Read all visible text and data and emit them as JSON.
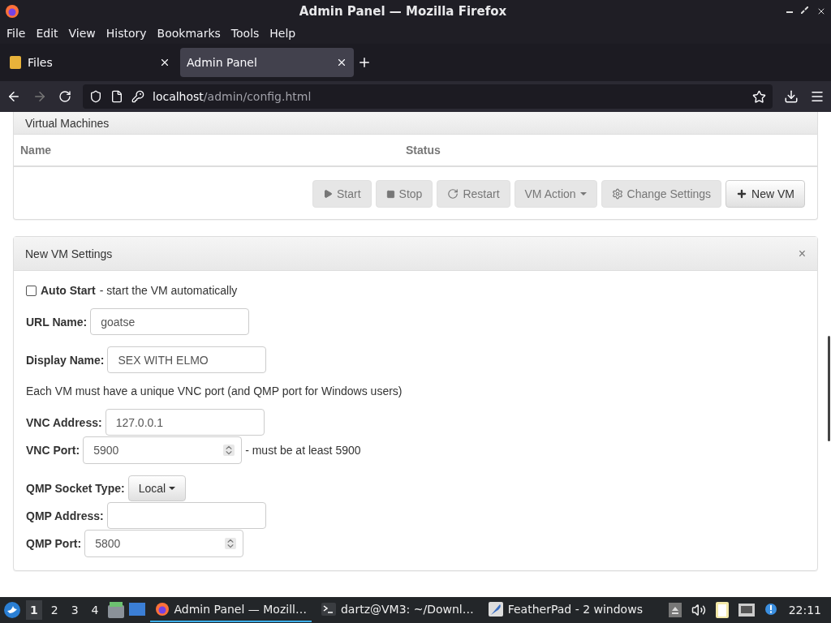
{
  "window": {
    "title": "Admin Panel — Mozilla Firefox"
  },
  "menu": [
    "File",
    "Edit",
    "View",
    "History",
    "Bookmarks",
    "Tools",
    "Help"
  ],
  "tabs": [
    {
      "label": "Files",
      "selected": false
    },
    {
      "label": "Admin Panel",
      "selected": true
    }
  ],
  "address": {
    "host": "localhost",
    "path": "/admin/config.html"
  },
  "vm_panel": {
    "title": "Virtual Machines",
    "columns": [
      "Name",
      "Status"
    ],
    "buttons": [
      {
        "label": "Start",
        "kind": "start",
        "disabled": true
      },
      {
        "label": "Stop",
        "kind": "stop",
        "disabled": true
      },
      {
        "label": "Restart",
        "kind": "restart",
        "disabled": true
      },
      {
        "label": "VM Action",
        "kind": "dropdown",
        "disabled": true
      },
      {
        "label": "Change Settings",
        "kind": "settings",
        "disabled": true
      },
      {
        "label": "New VM",
        "kind": "new",
        "disabled": false
      }
    ]
  },
  "settings_panel": {
    "title": "New VM Settings",
    "close": "×",
    "auto_start": {
      "label": "Auto Start",
      "description": "- start the VM automatically",
      "checked": false
    },
    "sections": [
      [
        {
          "kind": "text",
          "label": "URL Name:",
          "value": "goatse"
        }
      ],
      [
        {
          "kind": "text",
          "label": "Display Name:",
          "value": "SEX WITH ELMO"
        }
      ],
      [
        {
          "kind": "note",
          "text": "Each VM must have a unique VNC port (and QMP port for Windows users)"
        }
      ],
      [
        {
          "kind": "text",
          "label": "VNC Address:",
          "value": "127.0.0.1"
        },
        {
          "kind": "number",
          "label": "VNC Port:",
          "value": "5900",
          "hint": "- must be at least 5900"
        }
      ],
      [
        {
          "kind": "select",
          "label": "QMP Socket Type:",
          "value": "Local"
        },
        {
          "kind": "text",
          "label": "QMP Address:"
        },
        {
          "kind": "number",
          "label": "QMP Port:",
          "value": "5800"
        }
      ]
    ]
  },
  "taskbar": {
    "workspaces": [
      {
        "label": "1",
        "selected": true
      },
      {
        "label": "2",
        "selected": false
      },
      {
        "label": "3",
        "selected": false
      },
      {
        "label": "4",
        "selected": false
      }
    ],
    "tasks": [
      {
        "label": "Admin Panel — Mozill…",
        "kind": "browser",
        "selected": true
      },
      {
        "label": "dartz@VM3: ~/Downl…",
        "kind": "terminal",
        "selected": false
      },
      {
        "label": "FeatherPad - 2 windows",
        "kind": "editor",
        "selected": false
      }
    ],
    "clock": "22:11"
  }
}
